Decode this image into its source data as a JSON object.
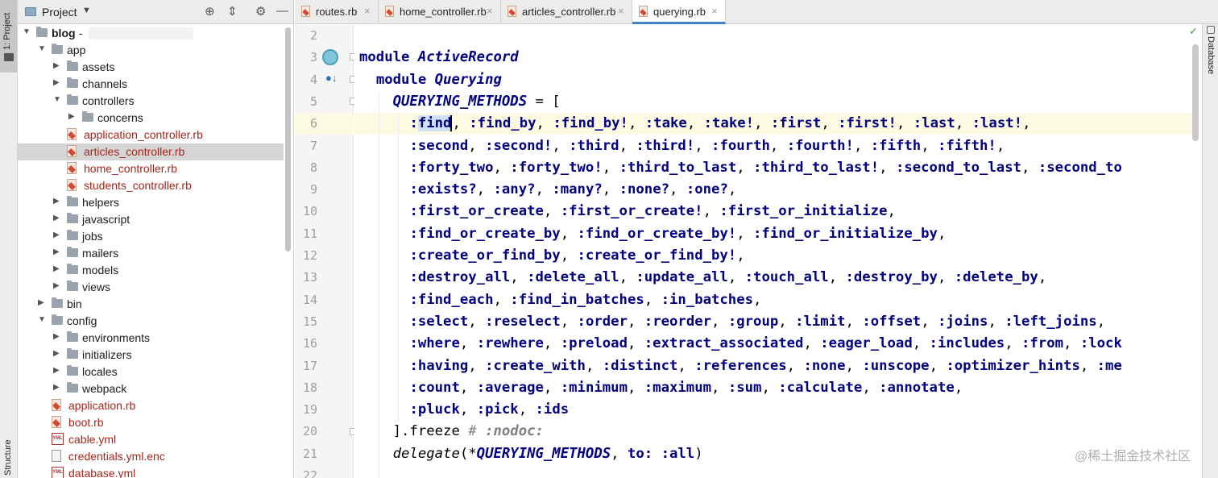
{
  "left_stripe": {
    "project_tab": "1: Project",
    "structure_tab": "Structure"
  },
  "project_panel": {
    "title": "Project",
    "tree": [
      {
        "label": "blog",
        "type": "folder",
        "depth": 0,
        "expanded": true,
        "bold": true,
        "suffix": "-"
      },
      {
        "label": "app",
        "type": "folder",
        "depth": 1,
        "expanded": true
      },
      {
        "label": "assets",
        "type": "folder",
        "depth": 2,
        "expanded": false
      },
      {
        "label": "channels",
        "type": "folder",
        "depth": 2,
        "expanded": false
      },
      {
        "label": "controllers",
        "type": "folder",
        "depth": 2,
        "expanded": true
      },
      {
        "label": "concerns",
        "type": "folder",
        "depth": 3,
        "expanded": false
      },
      {
        "label": "application_controller.rb",
        "type": "ruby",
        "depth": 3
      },
      {
        "label": "articles_controller.rb",
        "type": "ruby",
        "depth": 3,
        "selected": true
      },
      {
        "label": "home_controller.rb",
        "type": "ruby",
        "depth": 3
      },
      {
        "label": "students_controller.rb",
        "type": "ruby",
        "depth": 3
      },
      {
        "label": "helpers",
        "type": "folder",
        "depth": 2,
        "expanded": false
      },
      {
        "label": "javascript",
        "type": "folder",
        "depth": 2,
        "expanded": false
      },
      {
        "label": "jobs",
        "type": "folder",
        "depth": 2,
        "expanded": false
      },
      {
        "label": "mailers",
        "type": "folder",
        "depth": 2,
        "expanded": false
      },
      {
        "label": "models",
        "type": "folder",
        "depth": 2,
        "expanded": false
      },
      {
        "label": "views",
        "type": "folder",
        "depth": 2,
        "expanded": false
      },
      {
        "label": "bin",
        "type": "folder",
        "depth": 1,
        "expanded": false
      },
      {
        "label": "config",
        "type": "folder",
        "depth": 1,
        "expanded": true
      },
      {
        "label": "environments",
        "type": "folder",
        "depth": 2,
        "expanded": false
      },
      {
        "label": "initializers",
        "type": "folder",
        "depth": 2,
        "expanded": false
      },
      {
        "label": "locales",
        "type": "folder",
        "depth": 2,
        "expanded": false
      },
      {
        "label": "webpack",
        "type": "folder",
        "depth": 2,
        "expanded": false
      },
      {
        "label": "application.rb",
        "type": "ruby",
        "depth": 2
      },
      {
        "label": "boot.rb",
        "type": "ruby",
        "depth": 2
      },
      {
        "label": "cable.yml",
        "type": "yml",
        "depth": 2
      },
      {
        "label": "credentials.yml.enc",
        "type": "text",
        "depth": 2
      },
      {
        "label": "database.yml",
        "type": "yml",
        "depth": 2
      }
    ]
  },
  "tabs": [
    {
      "label": "routes.rb",
      "active": false
    },
    {
      "label": "home_controller.rb",
      "active": false
    },
    {
      "label": "articles_controller.rb",
      "active": false
    },
    {
      "label": "querying.rb",
      "active": true
    }
  ],
  "right_stripe": {
    "database_tab": "Database"
  },
  "editor": {
    "line_numbers": [
      "2",
      "3",
      "4",
      "5",
      "6",
      "7",
      "8",
      "9",
      "10",
      "11",
      "12",
      "13",
      "14",
      "15",
      "16",
      "17",
      "18",
      "19",
      "20",
      "21",
      "22"
    ],
    "current_line": "6",
    "code_lines": [
      "",
      "module ActiveRecord",
      "  module Querying",
      "    QUERYING_METHODS = [",
      "      :find, :find_by, :find_by!, :take, :take!, :first, :first!, :last, :last!,",
      "      :second, :second!, :third, :third!, :fourth, :fourth!, :fifth, :fifth!,",
      "      :forty_two, :forty_two!, :third_to_last, :third_to_last!, :second_to_last, :second_to",
      "      :exists?, :any?, :many?, :none?, :one?,",
      "      :first_or_create, :first_or_create!, :first_or_initialize,",
      "      :find_or_create_by, :find_or_create_by!, :find_or_initialize_by,",
      "      :create_or_find_by, :create_or_find_by!,",
      "      :destroy_all, :delete_all, :update_all, :touch_all, :destroy_by, :delete_by,",
      "      :find_each, :find_in_batches, :in_batches,",
      "      :select, :reselect, :order, :reorder, :group, :limit, :offset, :joins, :left_joins,",
      "      :where, :rewhere, :preload, :extract_associated, :eager_load, :includes, :from, :lock",
      "      :having, :create_with, :distinct, :references, :none, :unscope, :optimizer_hints, :me",
      "      :count, :average, :minimum, :maximum, :sum, :calculate, :annotate,",
      "      :pluck, :pick, :ids",
      "    ].freeze # :nodoc:",
      "    delegate(*QUERYING_METHODS, to: :all)",
      ""
    ]
  },
  "watermark": "@稀土掘金技术社区"
}
